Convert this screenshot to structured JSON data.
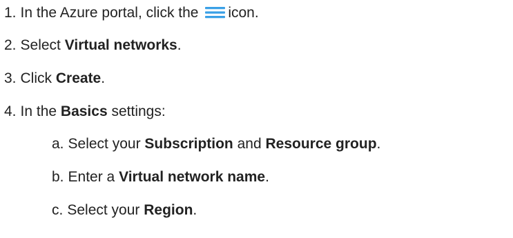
{
  "steps": [
    {
      "num": "1.",
      "pre": "In the Azure portal, click the",
      "post": "icon.",
      "icon": "hamburger-menu-icon",
      "icon_color": "#3aa0e6"
    },
    {
      "num": "2.",
      "pre": "Select",
      "bold": "Virtual networks",
      "post": "."
    },
    {
      "num": "3.",
      "pre": "Click",
      "bold": "Create",
      "post": "."
    },
    {
      "num": "4.",
      "pre": "In the",
      "bold": "Basics",
      "post": "settings:"
    }
  ],
  "substeps": [
    {
      "num": "a.",
      "pre": "Select your",
      "bold1": "Subscription",
      "mid": "and",
      "bold2": "Resource group",
      "post": "."
    },
    {
      "num": "b.",
      "pre": "Enter a",
      "bold": "Virtual network name",
      "post": "."
    },
    {
      "num": "c.",
      "pre": "Select your",
      "bold": "Region",
      "post": "."
    }
  ]
}
